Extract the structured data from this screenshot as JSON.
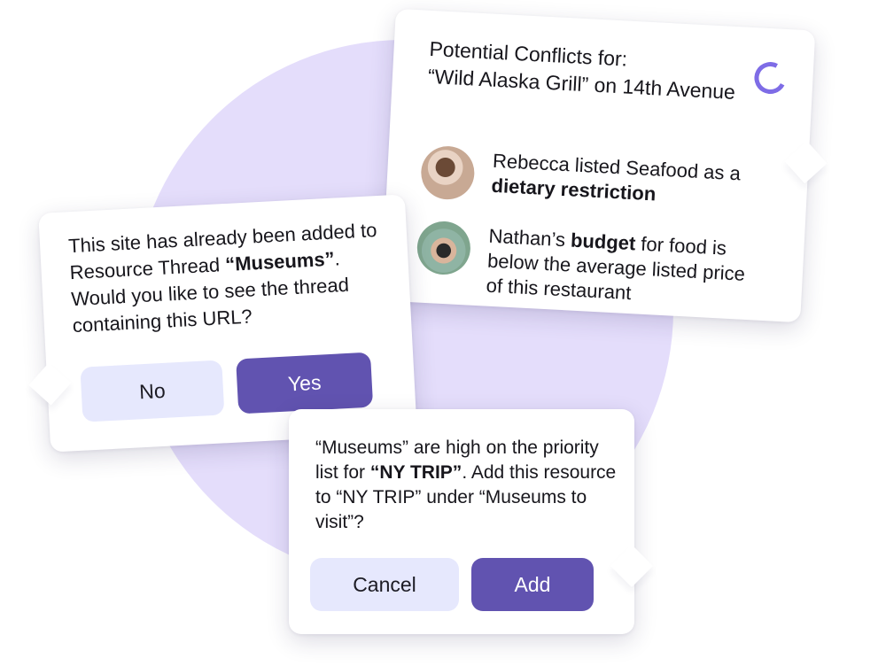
{
  "conflicts": {
    "title": "Potential Conflicts for:\n“Wild Alaska Grill” on 14th Avenue",
    "items": [
      {
        "name": "Rebecca",
        "pre": "Rebecca listed Seafood as a ",
        "bold": "dietary restriction",
        "post": ""
      },
      {
        "name": "Nathan",
        "pre": "Nathan’s ",
        "bold": "budget",
        "post": " for food is below the average listed price of this restaurant"
      }
    ]
  },
  "thread_prompt": {
    "pre": "This site has already been added to Resource Thread ",
    "bold": "“Museums”",
    "post": ". Would you like to see the thread containing this URL?",
    "no_label": "No",
    "yes_label": "Yes"
  },
  "trip_prompt": {
    "pre": "“Museums” are high on the priority list for ",
    "bold": "“NY TRIP”",
    "post": ". Add this resource to “NY TRIP” under “Museums to visit”?",
    "cancel_label": "Cancel",
    "add_label": "Add"
  },
  "colors": {
    "accent": "#6153b0",
    "light_button": "#e6e8fd",
    "background_blob": "#e4ddfb",
    "spinner": "#7e6ce6"
  },
  "icons": {
    "spinner": "loading-spinner-icon"
  }
}
